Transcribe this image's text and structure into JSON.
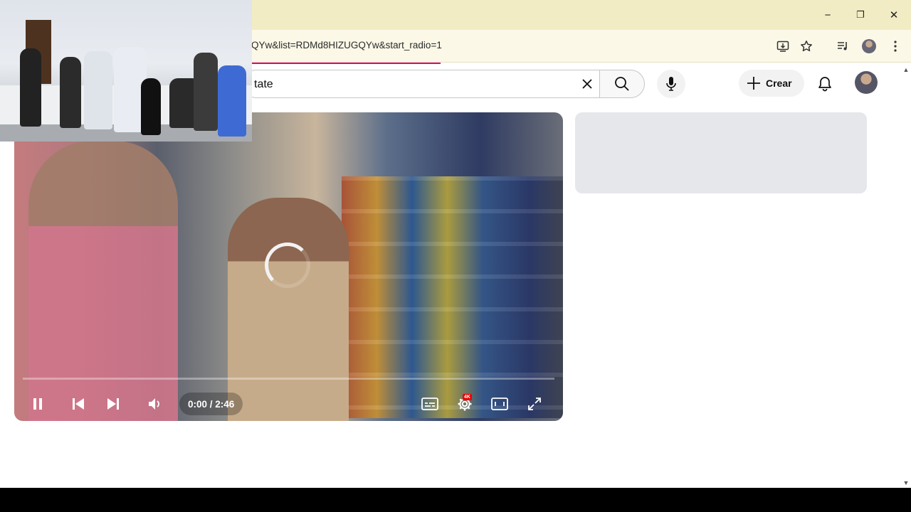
{
  "browser": {
    "url": "QYw&list=RDMd8HIZUGQYw&start_radio=1",
    "window_buttons": {
      "minimize": "−",
      "restore": "❐",
      "close": "✕"
    }
  },
  "header": {
    "search_query": "tate",
    "create_label": "Crear"
  },
  "player": {
    "time_display": "0:00 / 2:46",
    "quality_badge": "4K",
    "state": "loading"
  },
  "colors": {
    "titlebar": "#f1ecc4",
    "toolbar": "#fbf8e7",
    "load_progress": "#e4007c",
    "placeholder": "#e5e7ea"
  },
  "icons": [
    "install-icon",
    "bookmark-star-icon",
    "media-control-icon",
    "profile-avatar-icon",
    "more-menu-icon",
    "clear-icon",
    "search-icon",
    "mic-icon",
    "plus-icon",
    "bell-icon",
    "pause-icon",
    "previous-icon",
    "next-icon",
    "volume-icon",
    "subtitles-icon",
    "settings-icon",
    "theater-icon",
    "fullscreen-icon"
  ]
}
